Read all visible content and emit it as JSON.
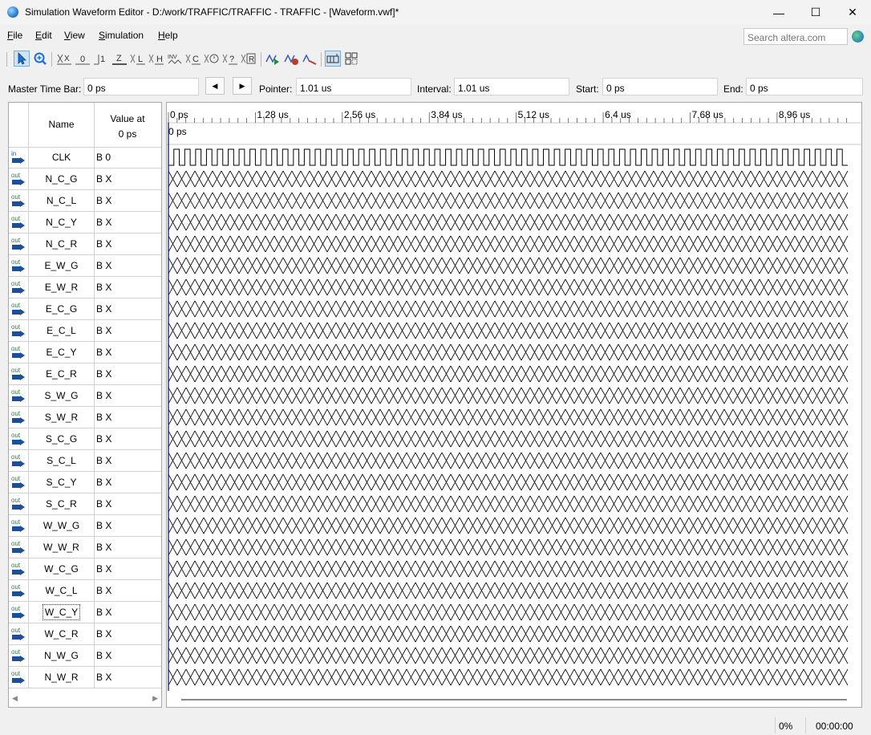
{
  "window": {
    "title": "Simulation Waveform Editor - D:/work/TRAFFIC/TRAFFIC - TRAFFIC - [Waveform.vwf]*",
    "controls": {
      "minimize": "—",
      "maximize": "☐",
      "close": "✕"
    }
  },
  "menu": [
    {
      "accel": "F",
      "rest": "ile"
    },
    {
      "accel": "E",
      "rest": "dit"
    },
    {
      "accel": "V",
      "rest": "iew"
    },
    {
      "accel": "S",
      "rest": "imulation"
    },
    {
      "accel": "H",
      "rest": "elp"
    }
  ],
  "search": {
    "placeholder": "Search altera.com"
  },
  "toolbar": {
    "icons": [
      "selection-tool-icon",
      "zoom-tool-icon",
      "forcing-unknown-icon",
      "forcing-low-icon",
      "forcing-high-icon",
      "high-impedance-icon",
      "weak-low-icon",
      "weak-high-icon",
      "invert-icon",
      "count-value-icon",
      "overwrite-clock-icon",
      "arbitrary-value-icon",
      "random-value-icon",
      "dont-care-icon",
      "run-functional-simulation-icon",
      "run-timing-simulation-icon",
      "generate-netlist-icon",
      "snap-to-grid-icon",
      "grid-settings-icon"
    ],
    "labels": {
      "x": "X",
      "zero": "0",
      "one": "1",
      "z": "Z",
      "l": "L",
      "h": "H",
      "inv": "INV",
      "c": "C",
      "q": "?",
      "r": "R"
    }
  },
  "timebar": {
    "master_label": "Master Time Bar:",
    "master_value": "0 ps",
    "pointer_label": "Pointer:",
    "pointer_value": "1.01 us",
    "interval_label": "Interval:",
    "interval_value": "1.01 us",
    "start_label": "Start:",
    "start_value": "0 ps",
    "end_label": "End:",
    "end_value": "0 ps",
    "prev_glyph": "◀",
    "next_glyph": "▶"
  },
  "signal_grid": {
    "name_header": "Name",
    "value_header_line1": "Value at",
    "value_header_line2": "0 ps",
    "input_tag": "in",
    "output_tag": "out",
    "scroll_left": "◀",
    "scroll_right": "▶",
    "signals": [
      {
        "name": "CLK",
        "dir": "in",
        "value": "B 0"
      },
      {
        "name": "N_C_G",
        "dir": "out",
        "value": "B X"
      },
      {
        "name": "N_C_L",
        "dir": "out",
        "value": "B X"
      },
      {
        "name": "N_C_Y",
        "dir": "out",
        "value": "B X"
      },
      {
        "name": "N_C_R",
        "dir": "out",
        "value": "B X"
      },
      {
        "name": "E_W_G",
        "dir": "out",
        "value": "B X"
      },
      {
        "name": "E_W_R",
        "dir": "out",
        "value": "B X"
      },
      {
        "name": "E_C_G",
        "dir": "out",
        "value": "B X"
      },
      {
        "name": "E_C_L",
        "dir": "out",
        "value": "B X"
      },
      {
        "name": "E_C_Y",
        "dir": "out",
        "value": "B X"
      },
      {
        "name": "E_C_R",
        "dir": "out",
        "value": "B X"
      },
      {
        "name": "S_W_G",
        "dir": "out",
        "value": "B X"
      },
      {
        "name": "S_W_R",
        "dir": "out",
        "value": "B X"
      },
      {
        "name": "S_C_G",
        "dir": "out",
        "value": "B X"
      },
      {
        "name": "S_C_L",
        "dir": "out",
        "value": "B X"
      },
      {
        "name": "S_C_Y",
        "dir": "out",
        "value": "B X"
      },
      {
        "name": "S_C_R",
        "dir": "out",
        "value": "B X"
      },
      {
        "name": "W_W_G",
        "dir": "out",
        "value": "B X"
      },
      {
        "name": "W_W_R",
        "dir": "out",
        "value": "B X"
      },
      {
        "name": "W_C_G",
        "dir": "out",
        "value": "B X"
      },
      {
        "name": "W_C_L",
        "dir": "out",
        "value": "B X"
      },
      {
        "name": "W_C_Y",
        "dir": "out",
        "value": "B X",
        "focused": true
      },
      {
        "name": "W_C_R",
        "dir": "out",
        "value": "B X"
      },
      {
        "name": "N_W_G",
        "dir": "out",
        "value": "B X"
      },
      {
        "name": "N_W_R",
        "dir": "out",
        "value": "B X"
      }
    ]
  },
  "waveform": {
    "ruler_labels": [
      "0 ps",
      "1.28 us",
      "2.56 us",
      "3.84 us",
      "5.12 us",
      "6.4 us",
      "7.68 us",
      "8.96 us"
    ],
    "ruler_step_us": 1.28,
    "view_end_us": 10.0,
    "master_time_label": "0 ps",
    "clock_period_us": 0.16,
    "clock_initial": 0,
    "unknown_value": "X",
    "colors": {
      "wave": "#000000",
      "master_bar": "#2a3ea3"
    }
  },
  "status": {
    "progress": "0%",
    "elapsed": "00:00:00"
  }
}
